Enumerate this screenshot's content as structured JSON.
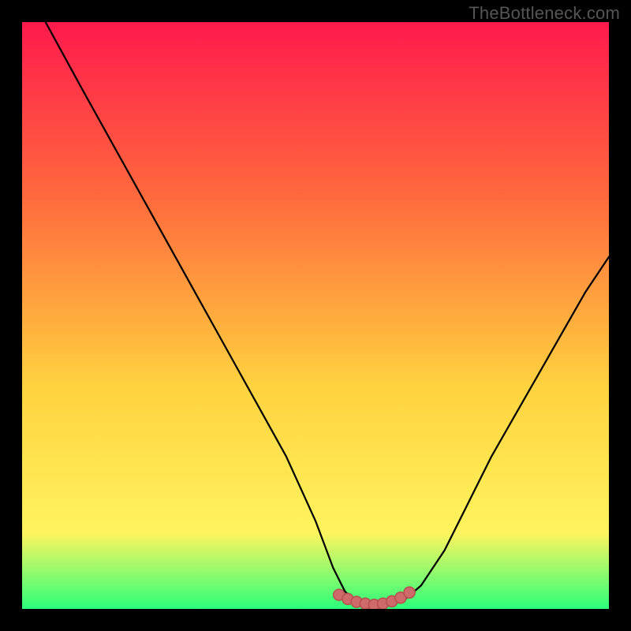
{
  "watermark": {
    "text": "TheBottleneck.com"
  },
  "colors": {
    "frame_bg": "#000000",
    "grad_top": "#ff1a4d",
    "grad_mid1": "#ff6a3d",
    "grad_mid2": "#ffd23f",
    "grad_mid3": "#fff45e",
    "grad_bottom": "#2cff7a",
    "curve": "#000000",
    "marker_fill": "#cf6a6a",
    "marker_stroke": "#b84d4d",
    "watermark": "#555555"
  },
  "chart_data": {
    "type": "line",
    "title": "",
    "xlabel": "",
    "ylabel": "",
    "xlim": [
      0,
      100
    ],
    "ylim": [
      0,
      100
    ],
    "series": [
      {
        "name": "curve",
        "x": [
          4,
          10,
          15,
          20,
          25,
          30,
          35,
          40,
          45,
          50,
          53,
          55,
          57,
          59,
          61,
          63,
          65,
          68,
          72,
          76,
          80,
          84,
          88,
          92,
          96,
          100
        ],
        "values": [
          100,
          89,
          80,
          71,
          62,
          53,
          44,
          35,
          26,
          15,
          7,
          3,
          1.2,
          0.8,
          0.6,
          0.8,
          1.4,
          4,
          10,
          18,
          26,
          33,
          40,
          47,
          54,
          60
        ]
      }
    ],
    "markers": {
      "name": "bottom-markers",
      "x": [
        54,
        55.5,
        57,
        58.5,
        60,
        61.5,
        63,
        64.5,
        66
      ],
      "values": [
        2.4,
        1.7,
        1.2,
        0.9,
        0.7,
        0.9,
        1.3,
        1.9,
        2.8
      ]
    }
  }
}
